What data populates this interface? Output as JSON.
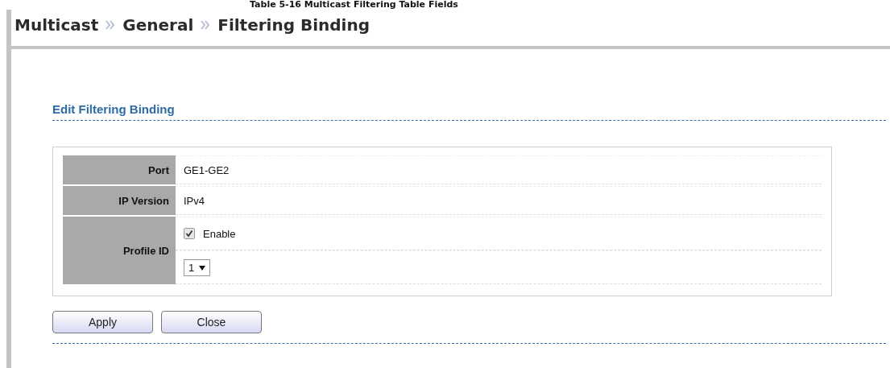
{
  "caption": "Table 5-16 Multicast Filtering Table Fields",
  "breadcrumb": [
    {
      "label": "Multicast"
    },
    {
      "label": "General"
    },
    {
      "label": "Filtering Binding"
    }
  ],
  "section": {
    "title": "Edit Filtering Binding"
  },
  "fields": [
    {
      "label": "Port",
      "kind": "text",
      "value": "GE1-GE2"
    },
    {
      "label": "IP Version",
      "kind": "text",
      "value": "IPv4"
    },
    {
      "label": "Profile ID",
      "kind": "profile",
      "checkbox_label": "Enable",
      "checked": true,
      "select_value": "1"
    }
  ],
  "buttons": [
    "Apply",
    "Close"
  ]
}
